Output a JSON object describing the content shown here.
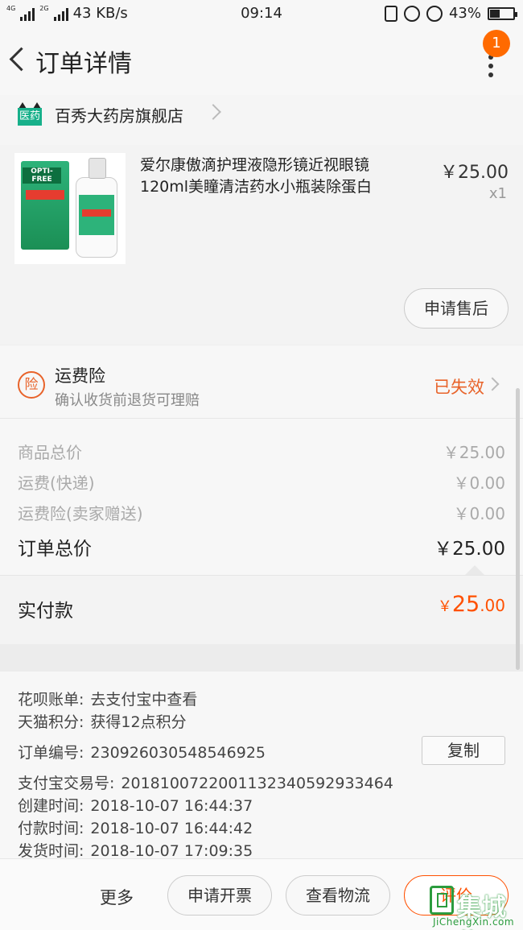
{
  "status_bar": {
    "network_speed": "43 KB/s",
    "net_type_1": "4G",
    "net_type_2": "2G",
    "time": "09:14",
    "battery_percent": "43%",
    "battery_level": 0.43
  },
  "header": {
    "title": "订单详情",
    "badge_count": "1"
  },
  "store": {
    "logo_text": "医药",
    "name": "百秀大药房旗舰店"
  },
  "product": {
    "name": "爱尔康傲滴护理液隐形镜近视眼镜120ml美瞳清洁药水小瓶装除蛋白",
    "image_brand_text": "OPTI-FREE",
    "price": "￥25.00",
    "quantity": "x1",
    "after_sale_label": "申请售后"
  },
  "insurance": {
    "icon_text": "险",
    "title": "运费险",
    "subtitle": "确认收货前退货可理赔",
    "status": "已失效",
    "status_color": "#e8632a"
  },
  "summary": {
    "rows": [
      {
        "label": "商品总价",
        "value": "￥25.00"
      },
      {
        "label": "运费(快递)",
        "value": "￥0.00"
      },
      {
        "label": "运费险(卖家赠送)",
        "value": "￥0.00"
      }
    ],
    "total_label": "订单总价",
    "total_value": "￥25.00",
    "paid_label": "实付款",
    "paid_currency": "￥",
    "paid_int": "25",
    "paid_dec": ".00",
    "accent_color": "#ff5000"
  },
  "order_info": {
    "huabei_label": "花呗账单:",
    "huabei_value": "去支付宝中查看",
    "points_label": "天猫积分:",
    "points_value": "获得12点积分",
    "order_no_label": "订单编号:",
    "order_no_value": "230926030548546925",
    "copy_label": "复制",
    "alipay_label": "支付宝交易号:",
    "alipay_value": "2018100722001132340592933464",
    "created_label": "创建时间:",
    "created_value": "2018-10-07 16:44:37",
    "paid_label": "付款时间:",
    "paid_value": "2018-10-07 16:44:42",
    "shipped_label": "发货时间:",
    "shipped_value": "2018-10-07 17:09:35"
  },
  "bottom_bar": {
    "more_label": "更多",
    "invoice_label": "申请开票",
    "logistics_label": "查看物流",
    "review_label": "评价"
  },
  "watermark": {
    "cn_text": "集城信",
    "en_text": "JiChengXin.com"
  }
}
